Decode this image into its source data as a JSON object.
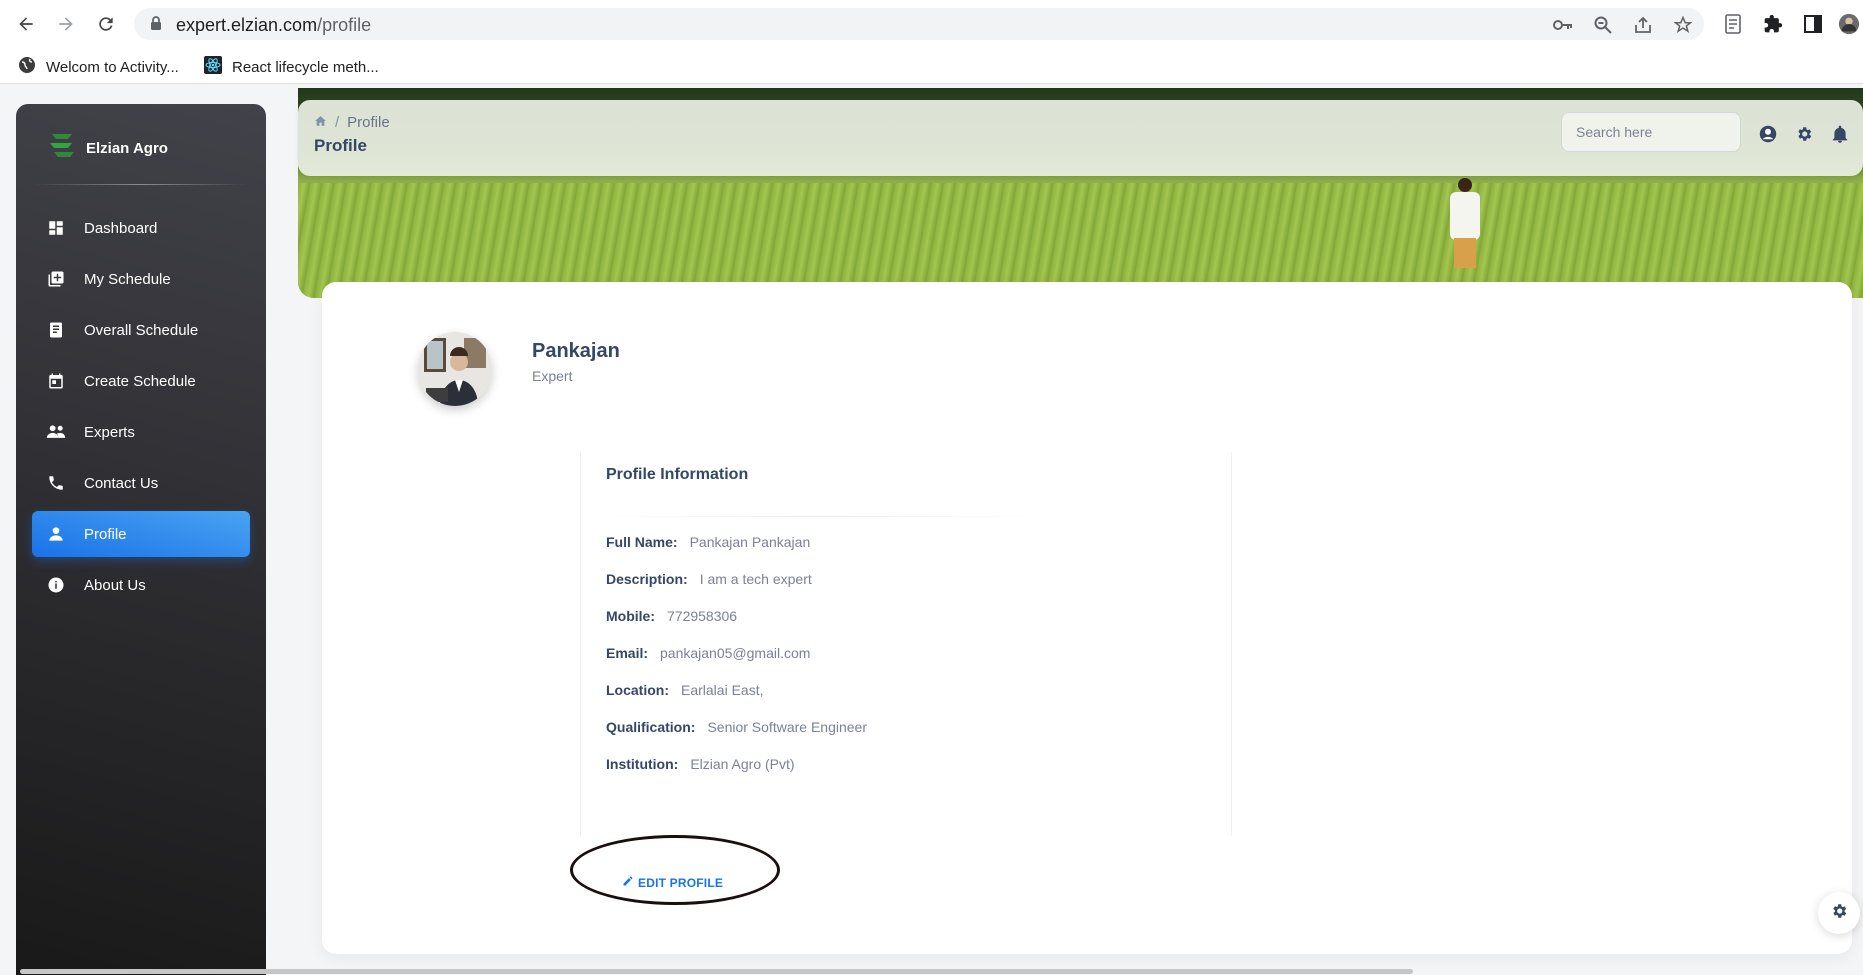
{
  "browser": {
    "url_host": "expert.elzian.com",
    "url_path": "/profile",
    "bookmarks": [
      {
        "label": "Welcom to Activity...",
        "icon": "globe-icon"
      },
      {
        "label": "React lifecycle meth...",
        "icon": "react-icon"
      }
    ]
  },
  "sidebar": {
    "brand": "Elzian Agro",
    "items": [
      {
        "label": "Dashboard",
        "icon": "dashboard-icon"
      },
      {
        "label": "My Schedule",
        "icon": "schedule-icon"
      },
      {
        "label": "Overall Schedule",
        "icon": "receipt-icon"
      },
      {
        "label": "Create Schedule",
        "icon": "calendar-icon"
      },
      {
        "label": "Experts",
        "icon": "people-icon"
      },
      {
        "label": "Contact Us",
        "icon": "phone-icon"
      },
      {
        "label": "Profile",
        "icon": "person-icon",
        "active": true
      },
      {
        "label": "About Us",
        "icon": "info-icon"
      }
    ]
  },
  "topnav": {
    "breadcrumb": "Profile",
    "title": "Profile",
    "search_placeholder": "Search here"
  },
  "profile": {
    "name": "Pankajan",
    "role": "Expert",
    "info_title": "Profile Information",
    "fields": [
      {
        "label": "Full Name:",
        "value": "Pankajan Pankajan"
      },
      {
        "label": "Description:",
        "value": "I am a tech expert"
      },
      {
        "label": "Mobile:",
        "value": "772958306"
      },
      {
        "label": "Email:",
        "value": "pankajan05@gmail.com"
      },
      {
        "label": "Location:",
        "value": "Earlalai East,"
      },
      {
        "label": "Qualification:",
        "value": "Senior Software Engineer"
      },
      {
        "label": "Institution:",
        "value": "Elzian Agro (Pvt)"
      }
    ],
    "edit_label": "EDIT PROFILE"
  },
  "colors": {
    "accent": "#1A73E8",
    "sidebar_bg": "#191919",
    "heading": "#344767",
    "muted": "#7b809a"
  }
}
